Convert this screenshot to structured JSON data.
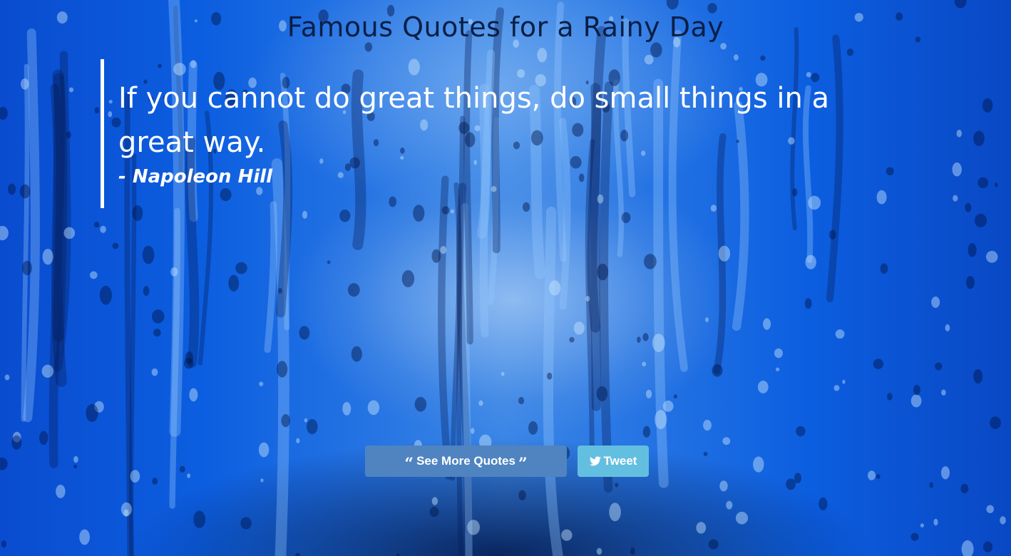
{
  "page": {
    "title": "Famous Quotes for a Rainy Day"
  },
  "quote": {
    "text": "If you cannot do great things, do small things in a great way.",
    "author": "- Napoleon Hill"
  },
  "buttons": {
    "more": {
      "label": "See More Quotes",
      "left_icon": "quote-left-icon",
      "right_icon": "quote-right-icon",
      "color": "#4f84c0"
    },
    "tweet": {
      "label": "Tweet",
      "icon": "twitter-bird-icon",
      "color": "#63bfe0"
    }
  },
  "colors": {
    "title_text": "#0a1f45",
    "quote_text": "#ffffff",
    "background": "#0a3f9a"
  }
}
